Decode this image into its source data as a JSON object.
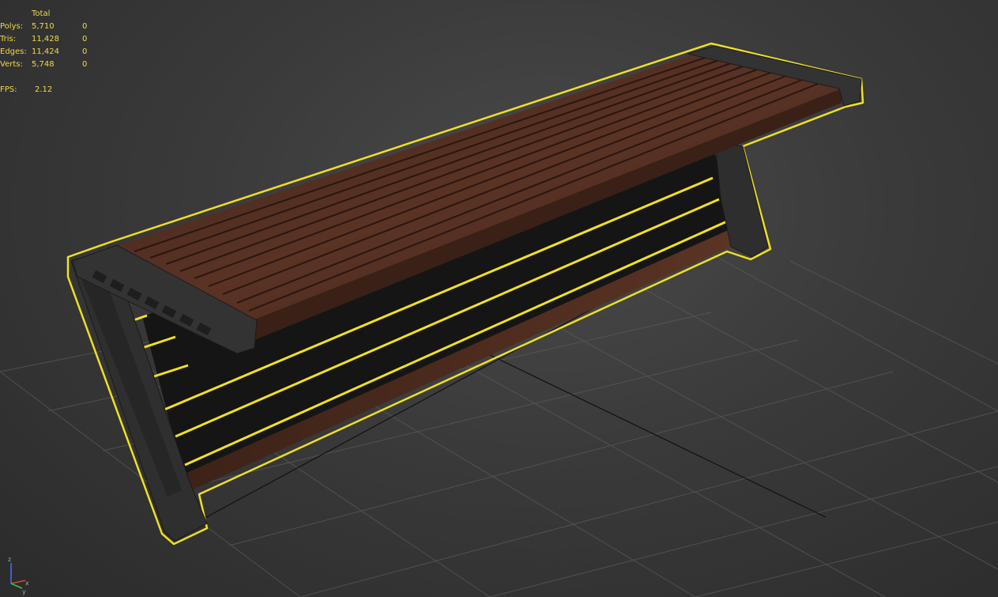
{
  "stats": {
    "header": "Total",
    "rows": [
      {
        "label": "Polys:",
        "total": "5,710",
        "selected": "0"
      },
      {
        "label": "Tris:",
        "total": "11,428",
        "selected": "0"
      },
      {
        "label": "Edges:",
        "total": "11,424",
        "selected": "0"
      },
      {
        "label": "Verts:",
        "total": "5,748",
        "selected": "0"
      }
    ],
    "fps_label": "FPS:",
    "fps_value": "2.12"
  },
  "colors": {
    "stats_text": "#f2d84a",
    "selection_outline": "#f0e020",
    "wood": "#4a2a1e",
    "metal": "#2f2f2f",
    "grid": "#5a5a5a"
  },
  "axis_gizmo": {
    "x_label": "x",
    "y_label": "y",
    "z_label": "z"
  }
}
